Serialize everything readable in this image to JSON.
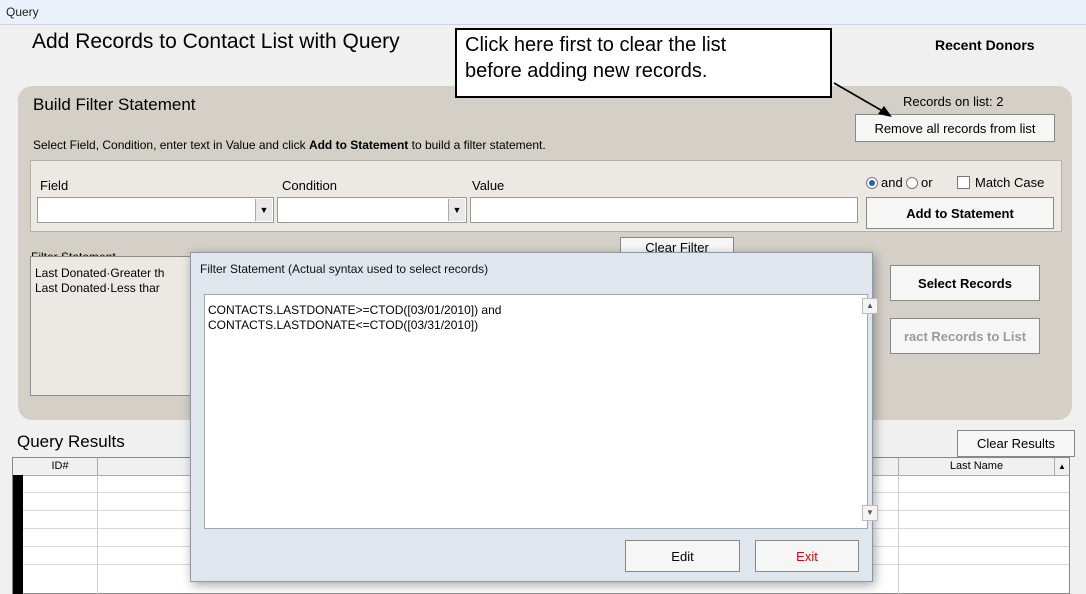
{
  "window": {
    "title": "Query"
  },
  "header": {
    "title": "Add Records to Contact List with Query",
    "list_name": "Recent Donors"
  },
  "callout": {
    "line1": "Click here first to clear the list",
    "line2": "before adding new records."
  },
  "build_filter": {
    "title": "Build Filter Statement",
    "instruction_pre": "Select Field, Condition, enter text in Value and click ",
    "instruction_bold": "Add to Statement",
    "instruction_post": " to build a filter statement.",
    "records_on_list": "Records on list: 2",
    "remove_button": "Remove all records from list",
    "field_label": "Field",
    "condition_label": "Condition",
    "value_label": "Value",
    "field_value": "",
    "condition_value": "",
    "value_value": "",
    "and_label": "and",
    "or_label": "or",
    "match_case_label": "Match Case",
    "and_selected": true,
    "match_case_checked": false,
    "add_button": "Add to Statement"
  },
  "filter_statement": {
    "label": "Filter Statement",
    "line1": "Last Donated·Greater th",
    "line2": "Last Donated·Less thar",
    "clear_button": "Clear Filter"
  },
  "actions": {
    "select_records": "Select Records",
    "extract_records": "ract Records to List"
  },
  "query_results": {
    "title": "Query Results",
    "clear_button": "Clear Results",
    "columns": [
      "ID#",
      "Last Name"
    ]
  },
  "dialog": {
    "title": "Filter Statement (Actual syntax used to select records)",
    "line1": "CONTACTS.LASTDONATE>=CTOD([03/01/2010]) and",
    "line2": "CONTACTS.LASTDONATE<=CTOD([03/31/2010])",
    "edit_button": "Edit",
    "exit_button": "Exit"
  },
  "colors": {
    "panel": "#d4d0c8",
    "exit_text": "#e00000",
    "radio_accent": "#1f62c5"
  }
}
